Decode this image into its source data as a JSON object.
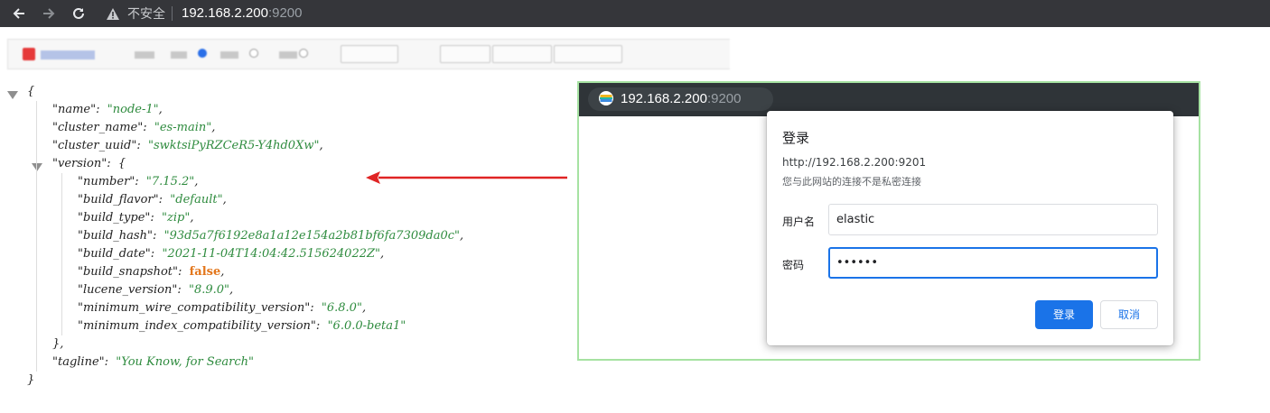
{
  "browser": {
    "security_label": "不安全",
    "address_host": "192.168.2.200",
    "address_port": ":9200"
  },
  "colors": {
    "accent": "#1a73e8",
    "json_string": "#2e8b3e",
    "json_bool": "#e3761b",
    "arrow": "#e02424",
    "topbar": "#35363a"
  },
  "json_lines": [
    {
      "indent": 0,
      "key": "",
      "value": "{",
      "type": "punct"
    },
    {
      "indent": 1,
      "key": "\"name\"",
      "value": "\"node-1\"",
      "type": "string",
      "comma": ","
    },
    {
      "indent": 1,
      "key": "\"cluster_name\"",
      "value": "\"es-main\"",
      "type": "string",
      "comma": ","
    },
    {
      "indent": 1,
      "key": "\"cluster_uuid\"",
      "value": "\"swktsiPyRZCeR5-Y4hd0Xw\"",
      "type": "string",
      "comma": ","
    },
    {
      "indent": 1,
      "key": "\"version\"",
      "value": "{",
      "type": "punct",
      "comma": ""
    },
    {
      "indent": 2,
      "key": "\"number\"",
      "value": "\"7.15.2\"",
      "type": "string",
      "comma": ","
    },
    {
      "indent": 2,
      "key": "\"build_flavor\"",
      "value": "\"default\"",
      "type": "string",
      "comma": ","
    },
    {
      "indent": 2,
      "key": "\"build_type\"",
      "value": "\"zip\"",
      "type": "string",
      "comma": ","
    },
    {
      "indent": 2,
      "key": "\"build_hash\"",
      "value": "\"93d5a7f6192e8a1a12e154a2b81bf6fa7309da0c\"",
      "type": "string",
      "comma": ","
    },
    {
      "indent": 2,
      "key": "\"build_date\"",
      "value": "\"2021-11-04T14:04:42.515624022Z\"",
      "type": "string",
      "comma": ","
    },
    {
      "indent": 2,
      "key": "\"build_snapshot\"",
      "value": "false",
      "type": "bool",
      "comma": ","
    },
    {
      "indent": 2,
      "key": "\"lucene_version\"",
      "value": "\"8.9.0\"",
      "type": "string",
      "comma": ","
    },
    {
      "indent": 2,
      "key": "\"minimum_wire_compatibility_version\"",
      "value": "\"6.8.0\"",
      "type": "string",
      "comma": ","
    },
    {
      "indent": 2,
      "key": "\"minimum_index_compatibility_version\"",
      "value": "\"6.0.0-beta1\"",
      "type": "string",
      "comma": ""
    },
    {
      "indent": 1,
      "key": "",
      "value": "},",
      "type": "punct"
    },
    {
      "indent": 1,
      "key": "\"tagline\"",
      "value": "\"You Know, for Search\"",
      "type": "string",
      "comma": ""
    },
    {
      "indent": 0,
      "key": "",
      "value": "}",
      "type": "punct"
    }
  ],
  "popup": {
    "host": "192.168.2.200",
    "port": ":9200"
  },
  "dialog": {
    "title": "登录",
    "url": "http://192.168.2.200:9201",
    "note": "您与此网站的连接不是私密连接",
    "username_label": "用户名",
    "username_value": "elastic",
    "password_label": "密码",
    "password_mask": "••••••",
    "login_button": "登录",
    "cancel_button": "取消"
  }
}
